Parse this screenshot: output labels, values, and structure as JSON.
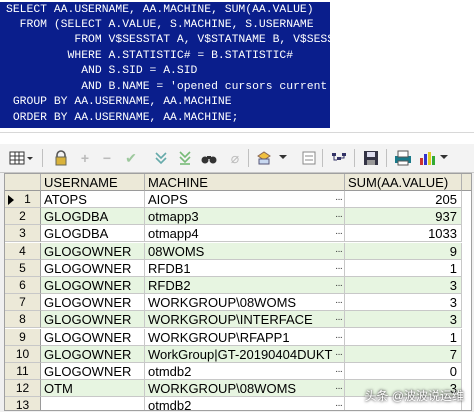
{
  "sql": {
    "lines": [
      "SELECT AA.USERNAME, AA.MACHINE, SUM(AA.VALUE)",
      "  FROM (SELECT A.VALUE, S.MACHINE, S.USERNAME",
      "          FROM V$SESSTAT A, V$STATNAME B, V$SESSION S",
      "         WHERE A.STATISTIC# = B.STATISTIC#",
      "           AND S.SID = A.SID",
      "           AND B.NAME = 'opened cursors current') AA",
      " GROUP BY AA.USERNAME, AA.MACHINE",
      " ORDER BY AA.USERNAME, AA.MACHINE;"
    ]
  },
  "grid": {
    "columns": [
      "USERNAME",
      "MACHINE",
      "SUM(AA.VALUE)"
    ],
    "rows": [
      {
        "n": "1",
        "user": "ATOPS",
        "machine": "AIOPS",
        "value": "205"
      },
      {
        "n": "2",
        "user": "GLOGDBA",
        "machine": "otmapp3",
        "value": "937"
      },
      {
        "n": "3",
        "user": "GLOGDBA",
        "machine": "otmapp4",
        "value": "1033"
      },
      {
        "n": "4",
        "user": "GLOGOWNER",
        "machine": "08WOMS",
        "value": "9"
      },
      {
        "n": "5",
        "user": "GLOGOWNER",
        "machine": "RFDB1",
        "value": "1"
      },
      {
        "n": "6",
        "user": "GLOGOWNER",
        "machine": "RFDB2",
        "value": "3"
      },
      {
        "n": "7",
        "user": "GLOGOWNER",
        "machine": "WORKGROUP\\08WOMS",
        "value": "3"
      },
      {
        "n": "8",
        "user": "GLOGOWNER",
        "machine": "WORKGROUP\\INTERFACE",
        "value": "3"
      },
      {
        "n": "9",
        "user": "GLOGOWNER",
        "machine": "WORKGROUP\\RFAPP1",
        "value": "1"
      },
      {
        "n": "10",
        "user": "GLOGOWNER",
        "machine": "WorkGroup|GT-20190404DUKT",
        "value": "7"
      },
      {
        "n": "11",
        "user": "GLOGOWNER",
        "machine": "otmdb2",
        "value": "0"
      },
      {
        "n": "12",
        "user": "OTM",
        "machine": "WORKGROUP\\08WOMS",
        "value": "3"
      },
      {
        "n": "13",
        "user": "",
        "machine": "otmdb2",
        "value": ""
      }
    ]
  },
  "watermark": "头条 @波波说运维"
}
